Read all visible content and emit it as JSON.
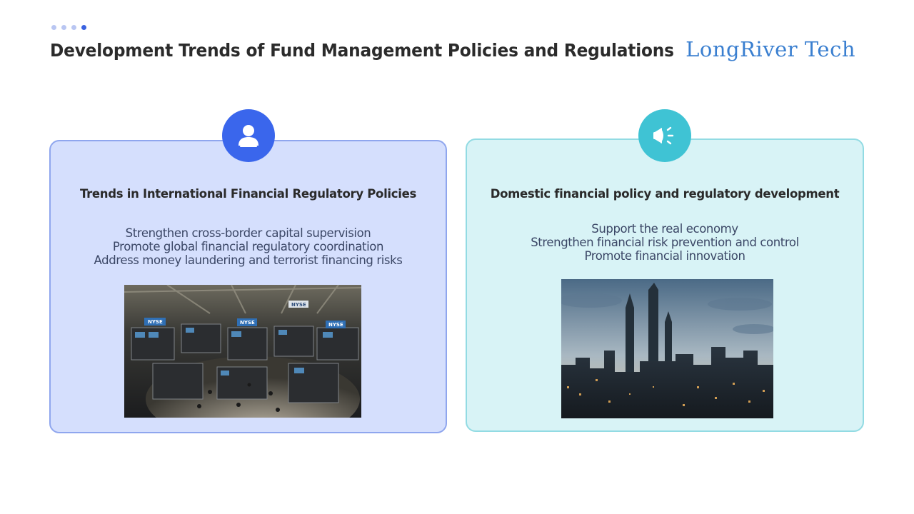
{
  "header": {
    "title": "Development Trends of Fund Management Policies and Regulations",
    "brand": "LongRiver Tech",
    "dots": 4,
    "active_dot": 4
  },
  "cards": [
    {
      "icon": "person-icon",
      "heading": "Trends in International Financial Regulatory Policies",
      "points": [
        "Strengthen cross-border capital supervision",
        "Promote global financial regulatory coordination",
        "Address money laundering and terrorist financing risks"
      ],
      "image": "stock-exchange-trading-floor-photo",
      "image_sign_text": "NYSE"
    },
    {
      "icon": "megaphone-icon",
      "heading": "Domestic financial policy and regulatory development",
      "points": [
        "Support the real economy",
        "Strengthen financial risk prevention and control",
        "Promote financial innovation"
      ],
      "image": "city-skyline-photo"
    }
  ],
  "colors": {
    "title": "#2b2b2b",
    "brand": "#3a7fd0",
    "left_card_bg": "#d5dffd",
    "left_card_border": "#8fa6ee",
    "left_badge": "#3a66ec",
    "right_card_bg": "#d8f3f6",
    "right_card_border": "#92dbe3",
    "right_badge": "#3fc3d4",
    "body_text": "#3b4766"
  }
}
